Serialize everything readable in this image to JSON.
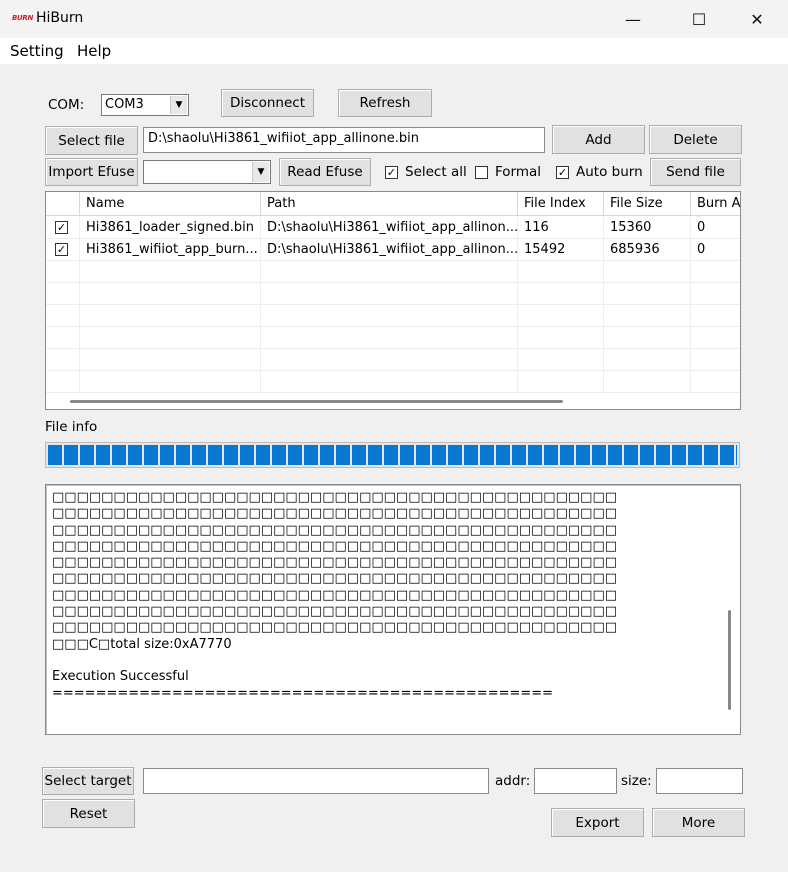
{
  "window": {
    "icon_text": "BURN",
    "title": "HiBurn",
    "minimize_glyph": "—",
    "maximize_glyph": "☐",
    "close_glyph": "✕"
  },
  "menu": {
    "setting": "Setting",
    "help": "Help"
  },
  "com": {
    "label": "COM:",
    "value": "COM3",
    "disconnect": "Disconnect",
    "refresh": "Refresh"
  },
  "file_row": {
    "select_file": "Select file",
    "path_value": "D:\\shaolu\\Hi3861_wifiiot_app_allinone.bin",
    "add": "Add",
    "delete": "Delete"
  },
  "efuse_row": {
    "import_efuse": "Import Efuse",
    "efuse_value": "",
    "read_efuse": "Read Efuse",
    "select_all": {
      "label": "Select all",
      "checked": true
    },
    "formal": {
      "label": "Formal",
      "checked": false
    },
    "auto_burn": {
      "label": "Auto burn",
      "checked": true
    },
    "send_file": "Send file"
  },
  "table": {
    "columns": [
      "",
      "Name",
      "Path",
      "File Index",
      "File Size",
      "Burn A"
    ],
    "rows": [
      {
        "checked": true,
        "name": "Hi3861_loader_signed.bin",
        "path": "D:\\shaolu\\Hi3861_wifiiot_app_allinon...",
        "file_index": "116",
        "file_size": "15360",
        "burn_addr": "0"
      },
      {
        "checked": true,
        "name": "Hi3861_wifiiot_app_burn...",
        "path": "D:\\shaolu\\Hi3861_wifiiot_app_allinon...",
        "file_index": "15492",
        "file_size": "685936",
        "burn_addr": "0"
      }
    ]
  },
  "file_info": {
    "label": "File info",
    "progress": 1.0
  },
  "log": {
    "lines": [
      "□□□□□□□□□□□□□□□□□□□□□□□□□□□□□□□□□□□□□□□□□□□□□□",
      "□□□□□□□□□□□□□□□□□□□□□□□□□□□□□□□□□□□□□□□□□□□□□□",
      "□□□□□□□□□□□□□□□□□□□□□□□□□□□□□□□□□□□□□□□□□□□□□□",
      "□□□□□□□□□□□□□□□□□□□□□□□□□□□□□□□□□□□□□□□□□□□□□□",
      "□□□□□□□□□□□□□□□□□□□□□□□□□□□□□□□□□□□□□□□□□□□□□□",
      "□□□□□□□□□□□□□□□□□□□□□□□□□□□□□□□□□□□□□□□□□□□□□□",
      "□□□□□□□□□□□□□□□□□□□□□□□□□□□□□□□□□□□□□□□□□□□□□□",
      "□□□□□□□□□□□□□□□□□□□□□□□□□□□□□□□□□□□□□□□□□□□□□□",
      "□□□□□□□□□□□□□□□□□□□□□□□□□□□□□□□□□□□□□□□□□□□□□□",
      "□□□C□total size:0xA7770",
      "",
      "Execution Successful",
      "=============================================="
    ]
  },
  "bottom": {
    "select_target": "Select target",
    "target_value": "",
    "addr_label": "addr:",
    "addr_value": "",
    "size_label": "size:",
    "size_value": "",
    "reset": "Reset",
    "export": "Export",
    "more": "More"
  }
}
